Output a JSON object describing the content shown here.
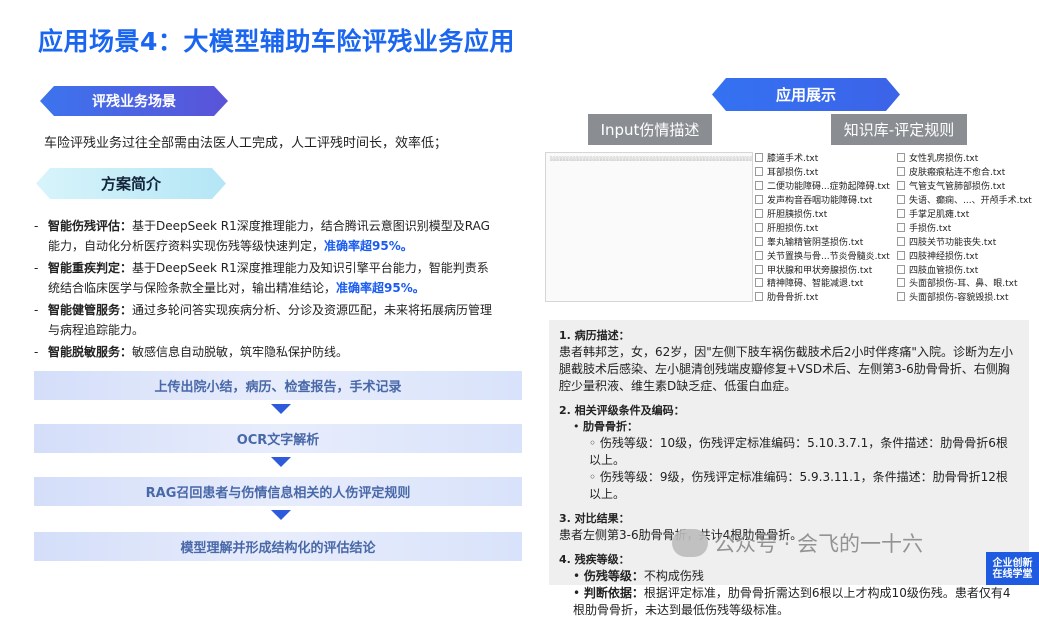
{
  "title": "应用场景4：大模型辅助车险评残业务应用",
  "scene": {
    "tag": "评残业务场景",
    "desc": "车险评残业务过往全部需由法医人工完成，人工评残时间长，效率低；"
  },
  "plan": {
    "tag": "方案简介",
    "items": [
      {
        "dash": "-",
        "label": "智能伤残评估：",
        "text": "基于DeepSeek R1深度推理能力，结合腾讯云意图识别模型及RAG能力，自动化分析医疗资料实现伤残等级快速判定，",
        "hl": "准确率超95%。"
      },
      {
        "dash": "-",
        "label": "智能重疾判定：",
        "text": "基于DeepSeek R1深度推理能力及知识引擎平台能力，智能判责系统结合临床医学与保险条款全量比对，输出精准结论，",
        "hl": "准确率超95%。"
      },
      {
        "dash": "-",
        "label": "智能健管服务：",
        "text": "通过多轮问答实现疾病分析、分诊及资源匹配，未来将拓展病历管理与病程追踪能力。",
        "hl": ""
      },
      {
        "dash": "-",
        "label": "智能脱敏服务：",
        "text": "敏感信息自动脱敏，筑牢隐私保护防线。",
        "hl": ""
      }
    ]
  },
  "flow": [
    "上传出院小结，病历、检查报告，手术记录",
    "OCR文字解析",
    "RAG召回患者与伤情信息相关的人伤评定规则",
    "模型理解并形成结构化的评估结论"
  ],
  "demo": {
    "tag": "应用展示",
    "input_label": "Input伤情描述",
    "kb_label": "知识库-评定规则",
    "files_col1": [
      "膝道手术.txt",
      "耳部损伤.txt",
      "二便功能障碍...症勃起障碍.txt",
      "发声构音吞咽功能障碍.txt",
      "肝胆胰损伤.txt",
      "肝胆损伤.txt",
      "睾丸输精管阴茎损伤.txt",
      "关节置换与骨...节炎骨髓炎.txt",
      "甲状腺和甲状旁腺损伤.txt",
      "精神障碍、智能减退.txt",
      "肋骨骨折.txt"
    ],
    "files_col2": [
      "女性乳房损伤.txt",
      "皮肤瘢痕粘连不愈合.txt",
      "气管支气管肺部损伤.txt",
      "失语、癫痫、...、开颅手术.txt",
      "手掌足肌瘫.txt",
      "手损伤.txt",
      "四肢关节功能丧失.txt",
      "四肢神经损伤.txt",
      "四肢血管损伤.txt",
      "头面部损伤-耳、鼻、眼.txt",
      "头面部损伤-容貌毁损.txt"
    ],
    "result": {
      "s1_title": "1. 病历描述：",
      "s1_text": "患者韩邦芝，女，62岁，因\"左侧下肢车祸伤截肢术后2小时伴疼痛\"入院。诊断为左小腿截肢术后感染、左小腿清创残端皮瓣修复+VSD术后、左侧第3-6肋骨骨折、右侧胸腔少量积液、维生素D缺乏症、低蛋白血症。",
      "s2_title": "2. 相关评级条件及编码：",
      "s2_sub": "肋骨骨折：",
      "s2_lines": [
        "伤残等级：10级，伤残评定标准编码：5.10.3.7.1，条件描述：肋骨骨折6根以上。",
        "伤残等级：9级，伤残评定标准编码：5.9.3.11.1，条件描述：肋骨骨折12根以上。"
      ],
      "s3_title": "3. 对比结果：",
      "s3_text": "患者左侧第3-6肋骨骨折，共计4根肋骨骨折。",
      "s4_title": "4. 残疾等级：",
      "s4_l1_label": "伤残等级：",
      "s4_l1_text": "不构成伤残",
      "s4_l2_label": "判断依据：",
      "s4_l2_text": "根据评定标准，肋骨骨折需达到6根以上才构成10级伤残。患者仅有4根肋骨骨折，未达到最低伤残等级标准。"
    }
  },
  "watermark": "公众号 · 会飞的一十六",
  "logo": "企业创新 在线学堂"
}
